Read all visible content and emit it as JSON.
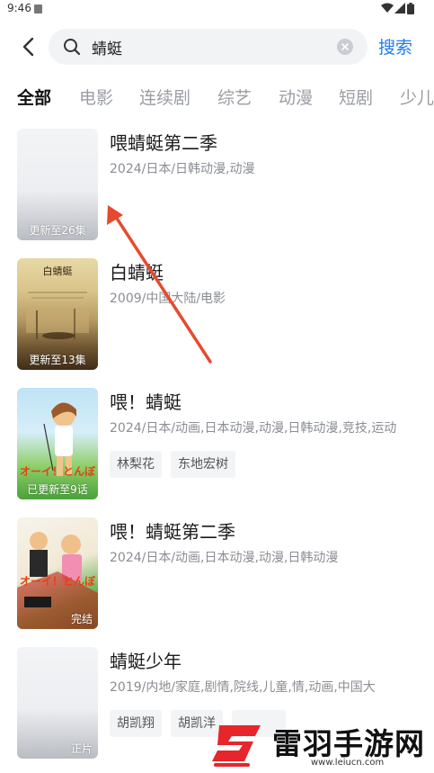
{
  "status_bar": {
    "time": "9:46",
    "icons": [
      "notification-icon",
      "wifi-icon",
      "signal-icon",
      "battery-icon"
    ]
  },
  "search": {
    "back_icon": "back-arrow-icon",
    "query": "蜻蜓",
    "placeholder": "",
    "clear_icon": "clear-icon",
    "submit_label": "搜索"
  },
  "tabs": [
    {
      "label": "全部",
      "active": true
    },
    {
      "label": "电影"
    },
    {
      "label": "连续剧"
    },
    {
      "label": "综艺"
    },
    {
      "label": "动漫"
    },
    {
      "label": "短剧"
    },
    {
      "label": "少儿"
    }
  ],
  "results": [
    {
      "title": "喂蜻蜓第二季",
      "meta": "2024/日本/日韩动漫,动漫",
      "poster_label": "更新至26集",
      "tags": []
    },
    {
      "title": "白蜻蜓",
      "meta": "2009/中国大陆/电影",
      "poster_label": "更新至13集",
      "poster_text": "白蜻蜓",
      "tags": []
    },
    {
      "title": "喂！蜻蜓",
      "meta": "2024/日本/动画,日本动漫,动漫,日韩动漫,竞技,运动",
      "poster_label": "已更新至9话",
      "poster_text": "オーイ！とんぼ",
      "tags": [
        "林梨花",
        "东地宏树"
      ]
    },
    {
      "title": "喂！蜻蜓第二季",
      "meta": "2024/日本/动画,日本动漫,动漫,日韩动漫",
      "poster_label": "完结",
      "poster_text": "オーイ！とんぼ",
      "tags": []
    },
    {
      "title": "蜻蜓少年",
      "meta": "2019/内地/家庭,剧情,院线,儿童,情,动画,中国大",
      "poster_label": "正片",
      "tags": [
        "胡凯翔",
        "胡凯洋",
        ""
      ]
    }
  ],
  "watermark": {
    "name": "雷羽手游网",
    "url": "www.leiucn.com"
  },
  "colors": {
    "accent": "#1f7cf0",
    "annotation_arrow": "#e64a2e",
    "muted": "#8a8d93"
  }
}
